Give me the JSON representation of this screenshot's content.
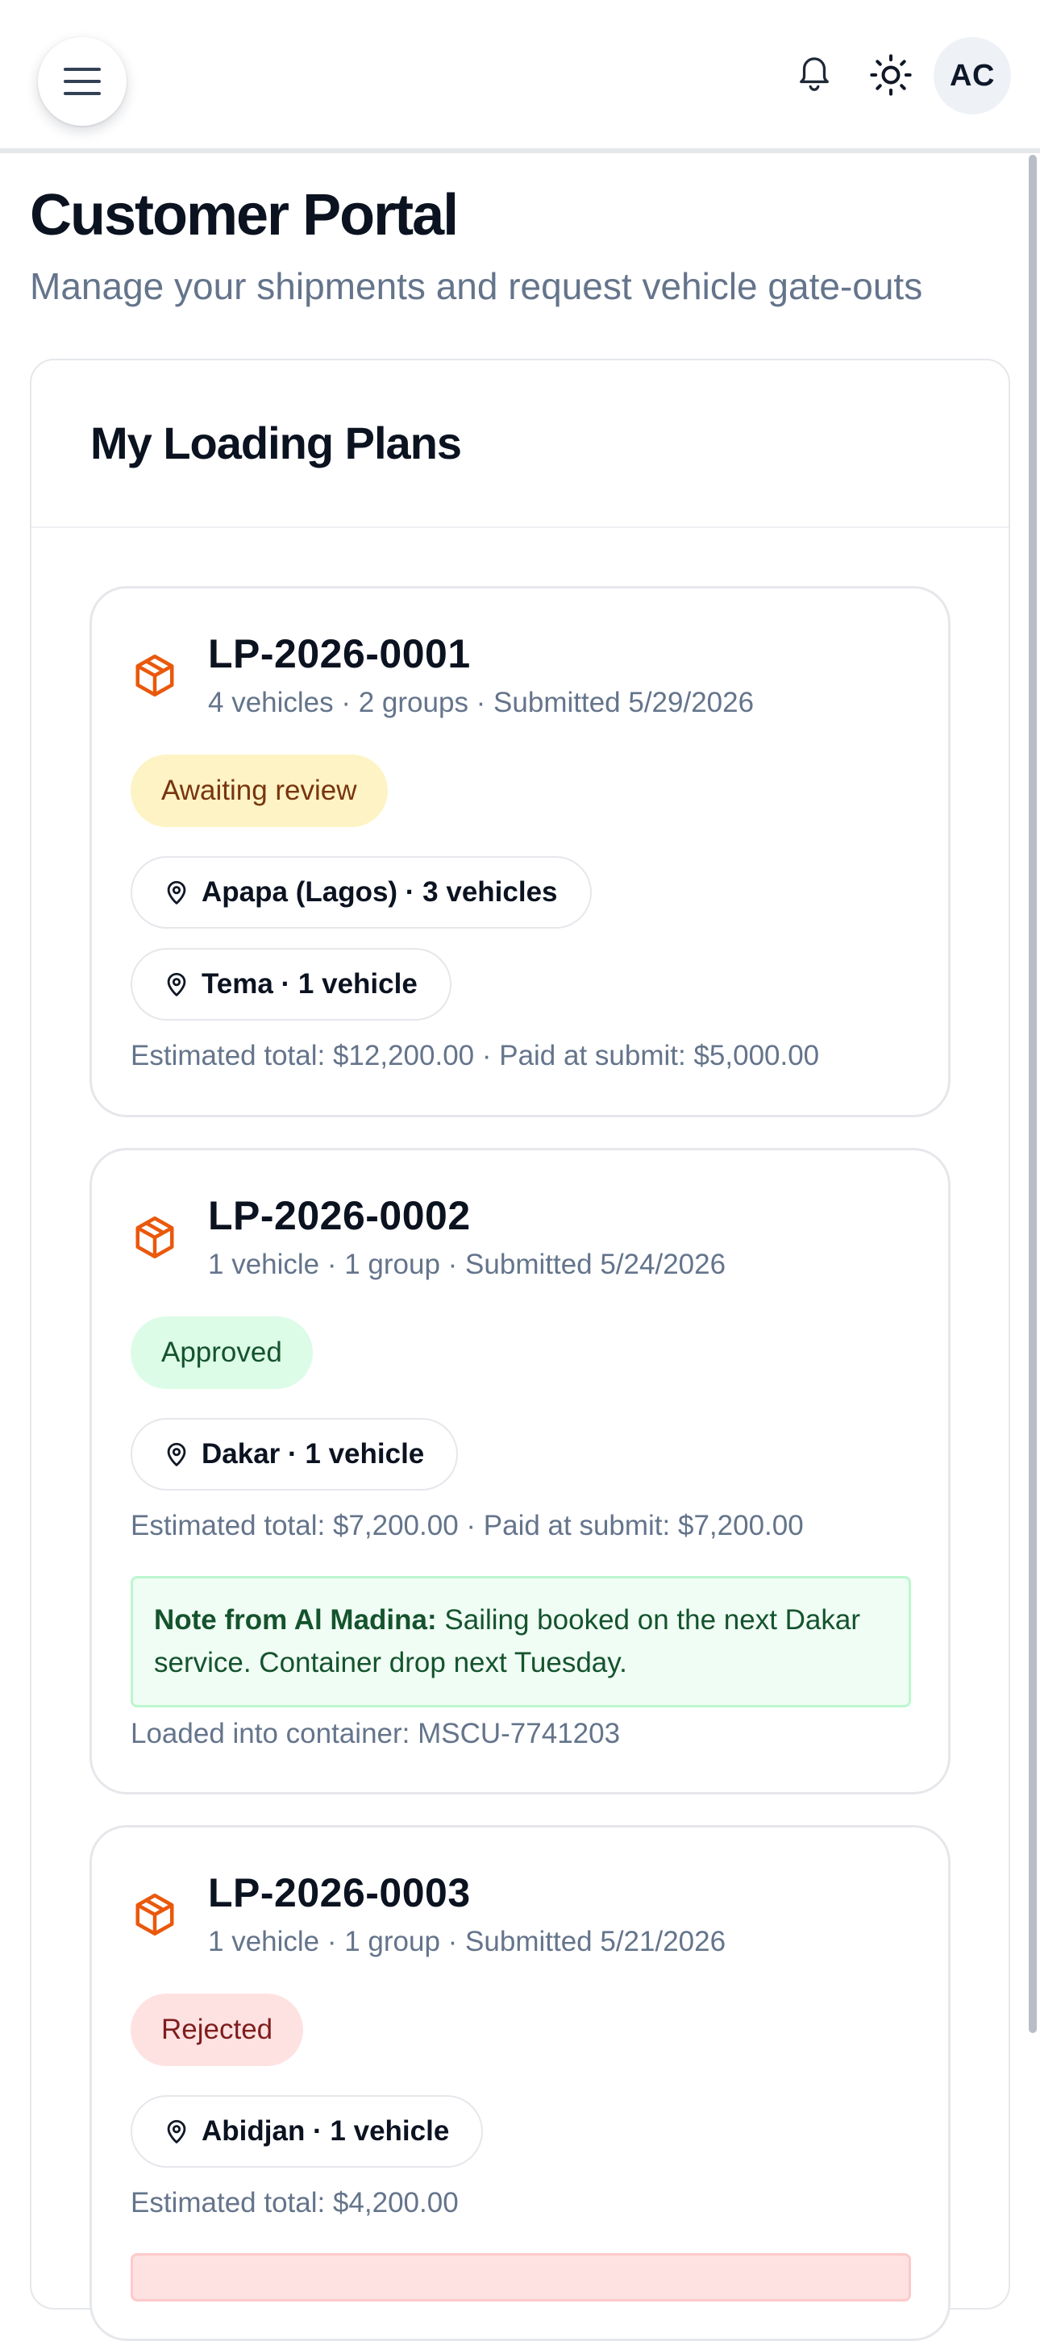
{
  "header": {
    "avatar_initials": "AC",
    "icons": {
      "menu": "menu-icon",
      "bell": "bell-icon",
      "theme": "sun-icon"
    }
  },
  "page": {
    "title": "Customer Portal",
    "subtitle": "Manage your shipments and request vehicle gate-outs"
  },
  "loading_plans": {
    "title": "My Loading Plans",
    "plans": [
      {
        "id": "LP-2026-0001",
        "meta": "4 vehicles · 2 groups · Submitted 5/29/2026",
        "status": "Awaiting review",
        "destinations": [
          "Apapa (Lagos) · 3 vehicles",
          "Tema · 1 vehicle"
        ],
        "totals": "Estimated total: $12,200.00 · Paid at submit: $5,000.00"
      },
      {
        "id": "LP-2026-0002",
        "meta": "1 vehicle · 1 group · Submitted 5/24/2026",
        "status": "Approved",
        "destinations": [
          "Dakar · 1 vehicle"
        ],
        "totals": "Estimated total: $7,200.00 · Paid at submit: $7,200.00",
        "note_label": "Note from Al Madina:",
        "note_text": " Sailing booked on the next Dakar service. Container drop next Tuesday.",
        "container": "Loaded into container: MSCU-7741203"
      },
      {
        "id": "LP-2026-0003",
        "meta": "1 vehicle · 1 group · Submitted 5/21/2026",
        "status": "Rejected",
        "destinations": [
          "Abidjan · 1 vehicle"
        ],
        "totals": "Estimated total: $4,200.00"
      }
    ]
  },
  "colors": {
    "accent_orange": "#ea580c",
    "awaiting_bg": "#fdf3c4",
    "approved_bg": "#dcfce7",
    "rejected_bg": "#fee2e2"
  }
}
